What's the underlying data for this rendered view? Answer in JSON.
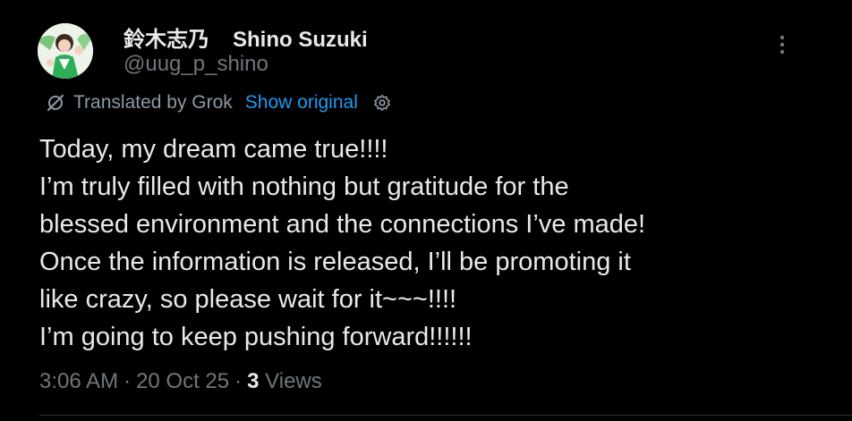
{
  "author": {
    "display_name_jp": "鈴木志乃",
    "display_name_en": "Shino Suzuki",
    "handle": "@uug_p_shino",
    "avatar_icon": "profile-photo"
  },
  "translation": {
    "label": "Translated by Grok",
    "show_original": "Show original",
    "settings_icon": "gear-icon"
  },
  "tweet": {
    "lines": [
      "Today, my dream came true!!!!",
      "I’m truly filled with nothing but gratitude for the",
      "blessed environment and the connections I’ve made!",
      "Once the information is released, I’ll be promoting it",
      "like crazy, so please wait for it~~~!!!!",
      "I’m going to keep pushing forward!!!!!!"
    ]
  },
  "meta": {
    "time": "3:06 AM",
    "date": "20 Oct 25",
    "views_count": "3",
    "views_label": "Views",
    "separator": "·"
  },
  "colors": {
    "background": "#000000",
    "text": "#e7e9ea",
    "secondary": "#71767b",
    "link": "#1d9bf0"
  }
}
